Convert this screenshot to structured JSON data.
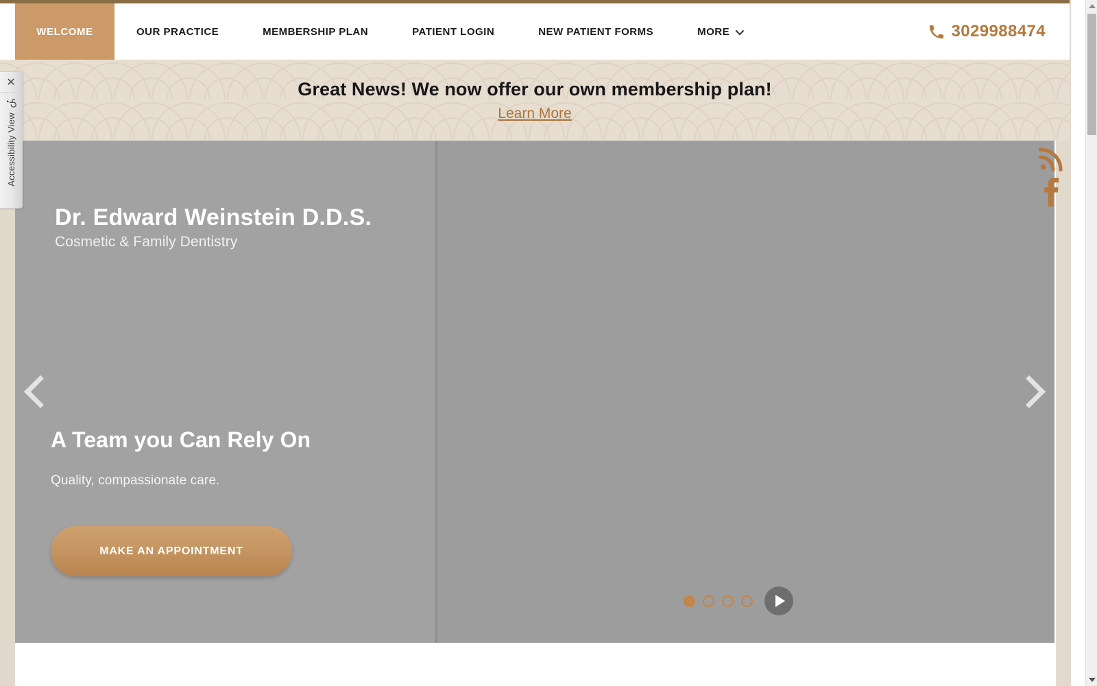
{
  "top_rule_color": "#8b6d45",
  "accent_color": "#c2864a",
  "nav": {
    "active_tab": "WELCOME",
    "links": [
      {
        "label": "OUR PRACTICE",
        "has_dropdown": false
      },
      {
        "label": "MEMBERSHIP PLAN",
        "has_dropdown": false
      },
      {
        "label": "PATIENT LOGIN",
        "has_dropdown": false
      },
      {
        "label": "NEW PATIENT FORMS",
        "has_dropdown": false
      },
      {
        "label": "MORE",
        "has_dropdown": true
      }
    ],
    "phone": {
      "number": "3029988474",
      "icon": "phone-icon",
      "color": "#b5793f"
    }
  },
  "banner": {
    "headline": "Great News! We now offer our own membership plan!",
    "link_label": "Learn More",
    "background_color": "#e7ddd0",
    "pattern": "seigaiha-fan-wave"
  },
  "hero": {
    "brand_name": "Dr. Edward Weinstein D.D.S.",
    "brand_tagline": "Cosmetic & Family Dentistry",
    "slide": {
      "headline": "A Team you Can Rely On",
      "subtext": "Quality, compassionate care.",
      "cta_label": "MAKE AN APPOINTMENT"
    },
    "prev_arrow_icon": "chevron-left-icon",
    "next_arrow_icon": "chevron-right-icon",
    "slide_count": 4,
    "active_slide": 1,
    "play_icon": "play-icon",
    "panel_color_left": "#a2a2a2",
    "panel_color_right": "#9d9d9d"
  },
  "social": [
    {
      "name": "rss-icon",
      "label": "RSS"
    },
    {
      "name": "facebook-icon",
      "label": "Facebook"
    }
  ],
  "accessibility_widget": {
    "close_label": "✕",
    "icon": "wheelchair-icon",
    "label": "Accessibility View"
  },
  "scrollbar": {
    "up_icon": "scroll-up-arrow-icon",
    "down_icon": "scroll-down-arrow-icon"
  }
}
